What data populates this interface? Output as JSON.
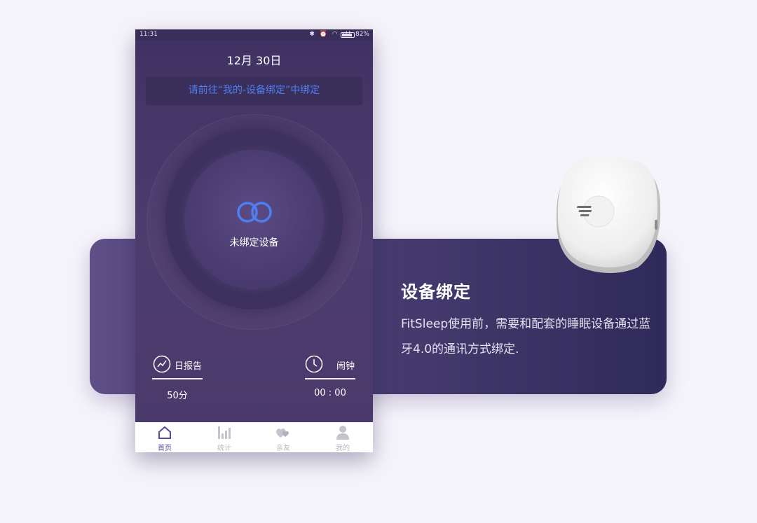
{
  "info": {
    "title": "设备绑定",
    "description": "FitSleep使用前，需要和配套的睡眠设备通过蓝牙4.0的通讯方式绑定."
  },
  "status_bar": {
    "time": "11:31",
    "battery": "82%"
  },
  "header": {
    "date": "12月 30日"
  },
  "banner": {
    "text": "请前往“我的-设备绑定”中绑定"
  },
  "center": {
    "status": "未绑定设备"
  },
  "stats": {
    "report": {
      "label": "日报告",
      "value": "50分"
    },
    "alarm": {
      "label": "闹钟",
      "value": "00 : 00"
    }
  },
  "tabs": [
    {
      "label": "首页",
      "active": true
    },
    {
      "label": "统计",
      "active": false
    },
    {
      "label": "亲友",
      "active": false
    },
    {
      "label": "我的",
      "active": false
    }
  ],
  "colors": {
    "accent": "#4f7ef0",
    "tab_active": "#5b4a9c",
    "phone_bg": "#463765"
  }
}
